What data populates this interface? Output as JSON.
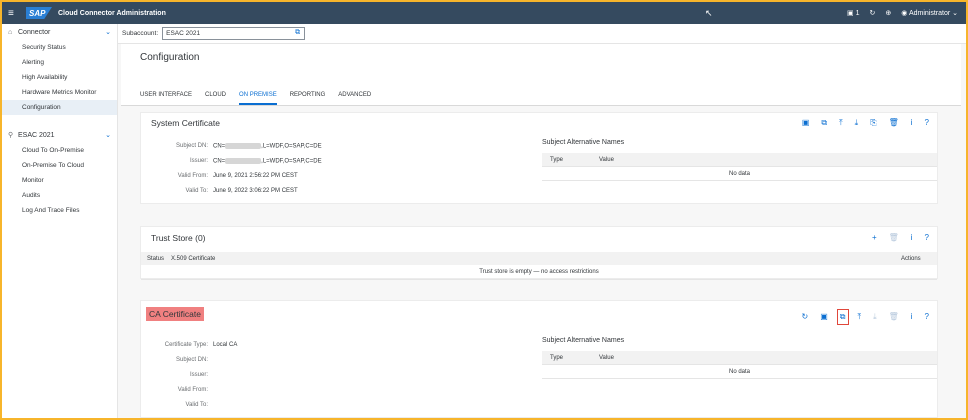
{
  "shell": {
    "title": "Cloud Connector Administration",
    "logo": "SAP",
    "notifications": "1",
    "user": "Administrator"
  },
  "sidebar": {
    "connector": {
      "label": "Connector",
      "items": [
        "Security Status",
        "Alerting",
        "High Availability",
        "Hardware Metrics Monitor",
        "Configuration"
      ]
    },
    "subaccount": {
      "label": "ESAC 2021",
      "items": [
        "Cloud To On-Premise",
        "On-Premise To Cloud",
        "Monitor",
        "Audits",
        "Log And Trace Files"
      ]
    }
  },
  "subaccount_bar": {
    "label": "Subaccount:",
    "value": "ESAC 2021"
  },
  "page": {
    "title": "Configuration",
    "tabs": [
      "USER INTERFACE",
      "CLOUD",
      "ON PREMISE",
      "REPORTING",
      "ADVANCED"
    ],
    "active_tab": "ON PREMISE"
  },
  "system_cert": {
    "title": "System Certificate",
    "fields": [
      {
        "k": "Subject DN:",
        "v1": "CN=",
        "v2": ",L=WDF,O=SAP,C=DE"
      },
      {
        "k": "Issuer:",
        "v1": "CN=",
        "v2": ",L=WDF,O=SAP,C=DE"
      },
      {
        "k": "Valid From:",
        "v1": "June 9, 2021 2:56:22 PM CEST",
        "v2": ""
      },
      {
        "k": "Valid To:",
        "v1": "June 9, 2022 3:06:22 PM CEST",
        "v2": ""
      }
    ]
  },
  "san": {
    "title": "Subject Alternative Names",
    "col_type": "Type",
    "col_value": "Value",
    "no_data": "No data"
  },
  "trust_store": {
    "title": "Trust Store",
    "count": "(0)",
    "col_status": "Status",
    "col_cert": "X.509 Certificate",
    "col_actions": "Actions",
    "empty": "Trust store is empty — no access restrictions"
  },
  "ca_cert": {
    "title": "CA Certificate",
    "fields": [
      {
        "k": "Certificate Type:",
        "v": "Local CA"
      },
      {
        "k": "Subject DN:",
        "v": ""
      },
      {
        "k": "Issuer:",
        "v": ""
      },
      {
        "k": "Valid From:",
        "v": ""
      },
      {
        "k": "Valid To:",
        "v": ""
      }
    ]
  },
  "colors": {
    "shell": "#354a5f",
    "accent": "#0a6ed1",
    "highlight": "#f08080",
    "frame": "#f7b52b"
  }
}
